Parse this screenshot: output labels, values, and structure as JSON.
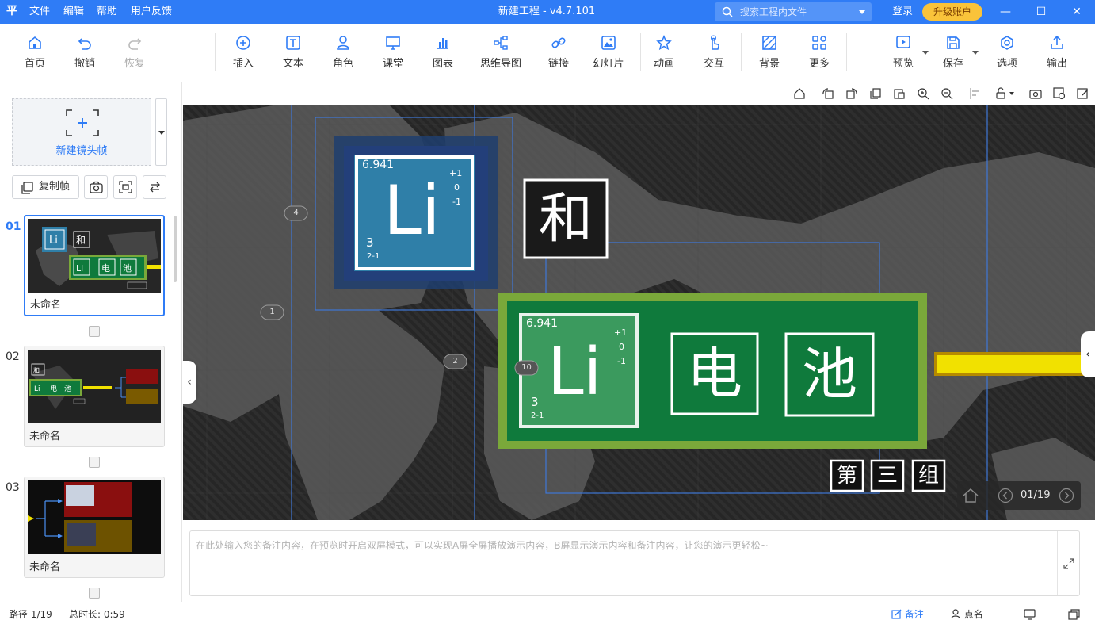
{
  "app": {
    "title": "新建工程 - v4.7.101",
    "logo": "平",
    "menu": [
      "文件",
      "编辑",
      "帮助",
      "用户反馈"
    ],
    "search_placeholder": "搜索工程内文件",
    "login": "登录",
    "upgrade": "升级账户",
    "window_controls": {
      "minimize": "—",
      "maximize": "☐",
      "close": "✕"
    }
  },
  "toolbar": {
    "home": "首页",
    "undo": "撤销",
    "redo": "恢复",
    "insert": "插入",
    "text": "文本",
    "role": "角色",
    "classroom": "课堂",
    "chart": "图表",
    "mindmap": "思维导图",
    "link": "链接",
    "slides": "幻灯片",
    "animation": "动画",
    "interaction": "交互",
    "background": "背景",
    "more": "更多",
    "preview": "预览",
    "save": "保存",
    "options": "选项",
    "export": "输出"
  },
  "left_panel": {
    "new_frame": "新建镜头帧",
    "copy_frame": "复制帧",
    "thumbnails": [
      {
        "num": "01",
        "caption": "未命名"
      },
      {
        "num": "02",
        "caption": "未命名"
      },
      {
        "num": "03",
        "caption": "未命名"
      }
    ]
  },
  "slide": {
    "element_top": {
      "mass": "6.941",
      "symbol": "Li",
      "number": "3",
      "config": "2-1",
      "ox": [
        "+1",
        "0",
        "-1"
      ]
    },
    "element_main": {
      "mass": "6.941",
      "symbol": "Li",
      "number": "3",
      "config": "2-1",
      "ox": [
        "+1",
        "0",
        "-1"
      ]
    },
    "char_he": "和",
    "char_dian": "电",
    "char_chi": "池",
    "group": [
      "第",
      "三",
      "组"
    ],
    "path_badges": [
      "4",
      "1",
      "2",
      "10"
    ],
    "nav_counter": "01/19"
  },
  "notes": {
    "placeholder": "在此处输入您的备注内容，在预览时开启双屏模式，可以实现A屏全屏播放演示内容，B屏显示演示内容和备注内容，让您的演示更轻松~"
  },
  "status": {
    "path": "路径 1/19",
    "total_time": "总时长: 0:59",
    "notes": "备注",
    "rollcall": "点名"
  },
  "colors": {
    "accent": "#2f7cf6",
    "element_blue": "#2f7fa8",
    "element_green": "#0f7a3c",
    "green_frame": "#7aa83a",
    "arrow_yellow": "#f1e100",
    "upgrade": "#f9c33a"
  }
}
